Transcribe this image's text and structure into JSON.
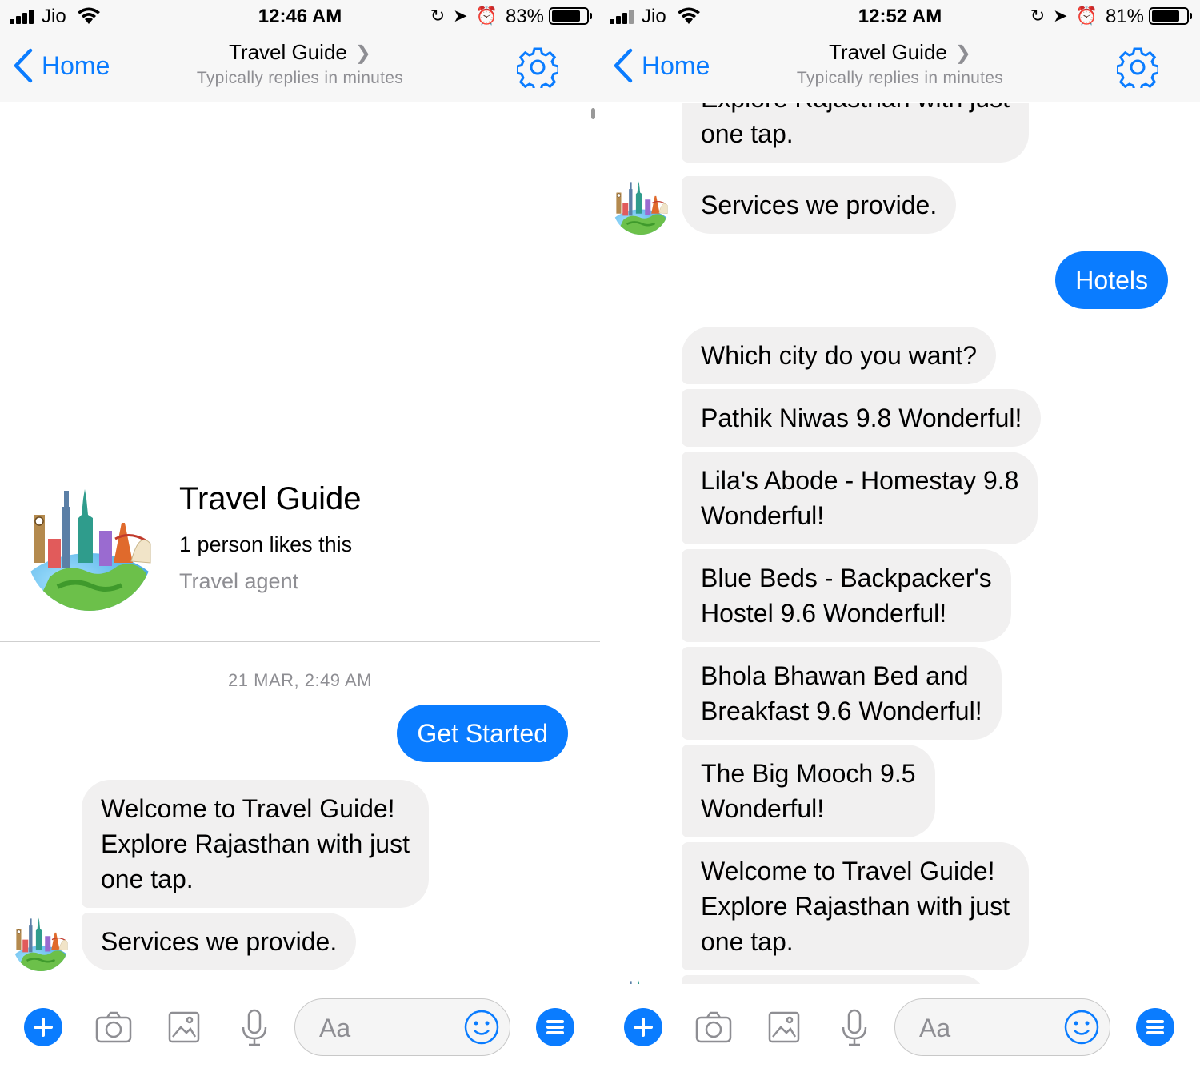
{
  "colors": {
    "accent": "#0a7cff",
    "incoming_bubble": "#f1f0f0",
    "secondary_text": "#8e8e93"
  },
  "left": {
    "status": {
      "carrier": "Jio",
      "time": "12:46 AM",
      "battery_pct": "83%",
      "battery_level": 0.83
    },
    "nav": {
      "back_label": "Home",
      "title": "Travel Guide",
      "subtitle": "Typically replies in minutes"
    },
    "profile": {
      "name": "Travel Guide",
      "likes": "1 person likes this",
      "category": "Travel agent"
    },
    "timestamp": "21 MAR, 2:49 AM",
    "messages": [
      {
        "from": "user",
        "text": "Get Started"
      },
      {
        "from": "bot",
        "lines": [
          "Welcome to Travel Guide!",
          "Explore Rajasthan with just",
          "one tap."
        ]
      },
      {
        "from": "bot",
        "lines": [
          "Services we provide."
        ]
      }
    ],
    "composer": {
      "placeholder": "Aa"
    }
  },
  "right": {
    "status": {
      "carrier": "Jio",
      "time": "12:52 AM",
      "battery_pct": "81%",
      "battery_level": 0.81
    },
    "nav": {
      "back_label": "Home",
      "title": "Travel Guide",
      "subtitle": "Typically replies in minutes"
    },
    "messages": [
      {
        "from": "bot",
        "lines": [
          "Explore Rajasthan with just",
          "one tap."
        ]
      },
      {
        "from": "bot",
        "lines": [
          "Services we provide."
        ]
      },
      {
        "from": "user",
        "text": "Hotels"
      },
      {
        "from": "bot",
        "lines": [
          "Which city do you want?"
        ]
      },
      {
        "from": "bot",
        "lines": [
          "Pathik Niwas 9.8  Wonderful!"
        ]
      },
      {
        "from": "bot",
        "lines": [
          "Lila's Abode - Homestay 9.8",
          "Wonderful!"
        ]
      },
      {
        "from": "bot",
        "lines": [
          "Blue Beds - Backpacker's",
          "Hostel 9.6  Wonderful!"
        ]
      },
      {
        "from": "bot",
        "lines": [
          "Bhola Bhawan Bed and",
          "Breakfast 9.6  Wonderful!"
        ]
      },
      {
        "from": "bot",
        "lines": [
          "The Big Mooch 9.5",
          "Wonderful!"
        ]
      },
      {
        "from": "bot",
        "lines": [
          "Welcome to Travel Guide!",
          "Explore Rajasthan with just",
          "one tap."
        ]
      }
    ],
    "composer": {
      "placeholder": "Aa"
    }
  }
}
